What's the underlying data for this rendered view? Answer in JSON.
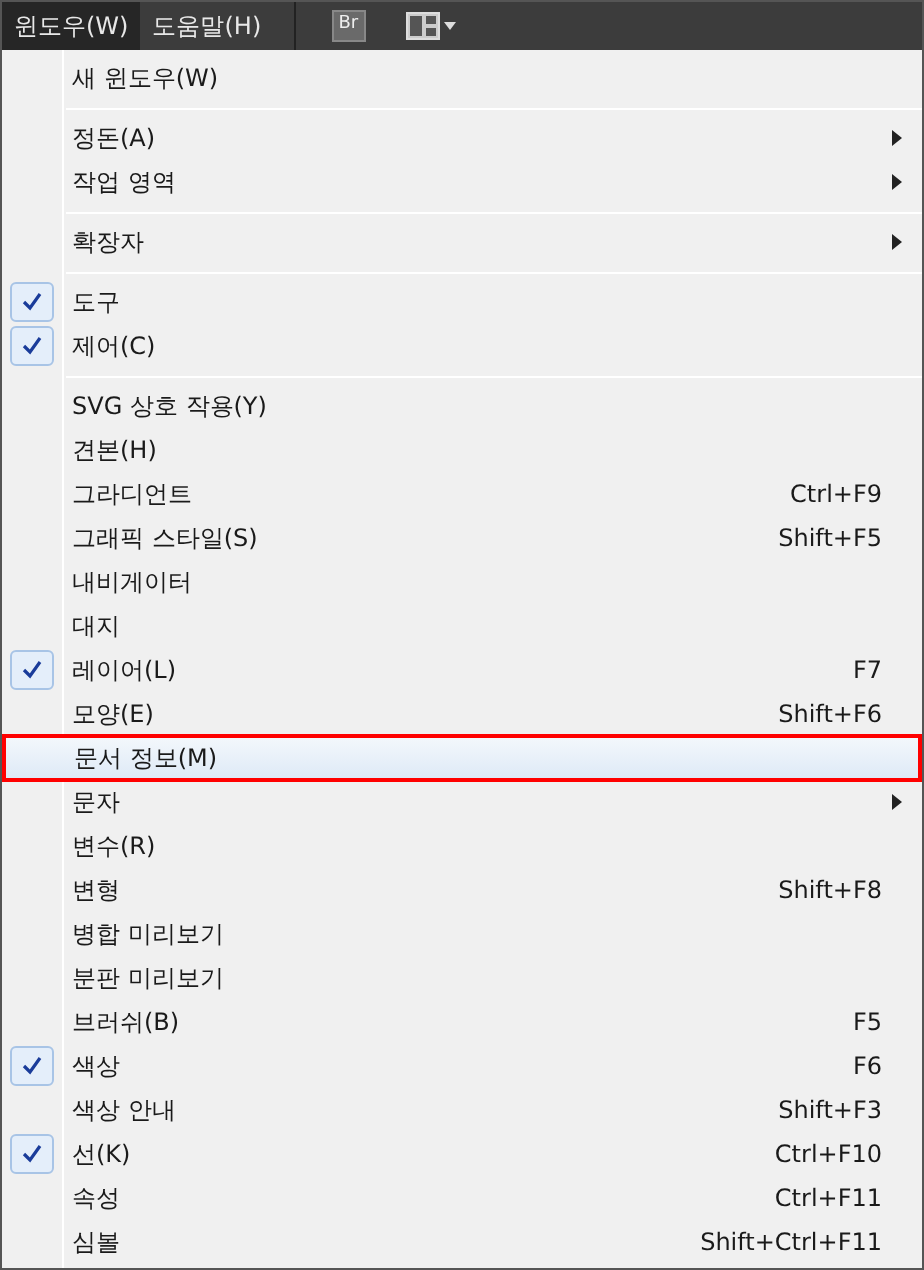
{
  "menu_bar": {
    "items": [
      {
        "label": "윈도우(W)",
        "selected": true
      },
      {
        "label": "도움말(H)",
        "selected": false
      }
    ],
    "bridge_button": "Br"
  },
  "menu": {
    "groups": [
      {
        "items": [
          {
            "label": "새 윈도우(W)",
            "checked": false,
            "submenu": false,
            "selected": false
          }
        ]
      },
      {
        "items": [
          {
            "label": "정돈(A)",
            "checked": false,
            "submenu": true,
            "selected": false
          },
          {
            "label": "작업 영역",
            "checked": false,
            "submenu": true,
            "selected": false
          }
        ]
      },
      {
        "items": [
          {
            "label": "확장자",
            "checked": false,
            "submenu": true,
            "selected": false
          }
        ]
      },
      {
        "items": [
          {
            "label": "도구",
            "checked": true,
            "submenu": false,
            "selected": false
          },
          {
            "label": "제어(C)",
            "checked": true,
            "submenu": false,
            "selected": false
          }
        ]
      },
      {
        "items": [
          {
            "label": "SVG 상호 작용(Y)",
            "checked": false,
            "submenu": false,
            "selected": false
          },
          {
            "label": "견본(H)",
            "checked": false,
            "submenu": false,
            "selected": false
          },
          {
            "label": "그라디언트",
            "shortcut": "Ctrl+F9",
            "checked": false,
            "submenu": false,
            "selected": false
          },
          {
            "label": "그래픽 스타일(S)",
            "shortcut": "Shift+F5",
            "checked": false,
            "submenu": false,
            "selected": false
          },
          {
            "label": "내비게이터",
            "checked": false,
            "submenu": false,
            "selected": false
          },
          {
            "label": "대지",
            "checked": false,
            "submenu": false,
            "selected": false
          },
          {
            "label": "레이어(L)",
            "shortcut": "F7",
            "checked": true,
            "submenu": false,
            "selected": false
          },
          {
            "label": "모양(E)",
            "shortcut": "Shift+F6",
            "checked": false,
            "submenu": false,
            "selected": false
          },
          {
            "label": "문서 정보(M)",
            "checked": false,
            "submenu": false,
            "selected": true
          },
          {
            "label": "문자",
            "checked": false,
            "submenu": true,
            "selected": false
          },
          {
            "label": "변수(R)",
            "checked": false,
            "submenu": false,
            "selected": false
          },
          {
            "label": "변형",
            "shortcut": "Shift+F8",
            "checked": false,
            "submenu": false,
            "selected": false
          },
          {
            "label": "병합 미리보기",
            "checked": false,
            "submenu": false,
            "selected": false
          },
          {
            "label": "분판 미리보기",
            "checked": false,
            "submenu": false,
            "selected": false
          },
          {
            "label": "브러쉬(B)",
            "shortcut": "F5",
            "checked": false,
            "submenu": false,
            "selected": false
          },
          {
            "label": "색상",
            "shortcut": "F6",
            "checked": true,
            "submenu": false,
            "selected": false
          },
          {
            "label": "색상 안내",
            "shortcut": "Shift+F3",
            "checked": false,
            "submenu": false,
            "selected": false
          },
          {
            "label": "선(K)",
            "shortcut": "Ctrl+F10",
            "checked": true,
            "submenu": false,
            "selected": false
          },
          {
            "label": "속성",
            "shortcut": "Ctrl+F11",
            "checked": false,
            "submenu": false,
            "selected": false
          },
          {
            "label": "심볼",
            "shortcut": "Shift+Ctrl+F11",
            "checked": false,
            "submenu": false,
            "selected": false
          }
        ]
      }
    ]
  }
}
